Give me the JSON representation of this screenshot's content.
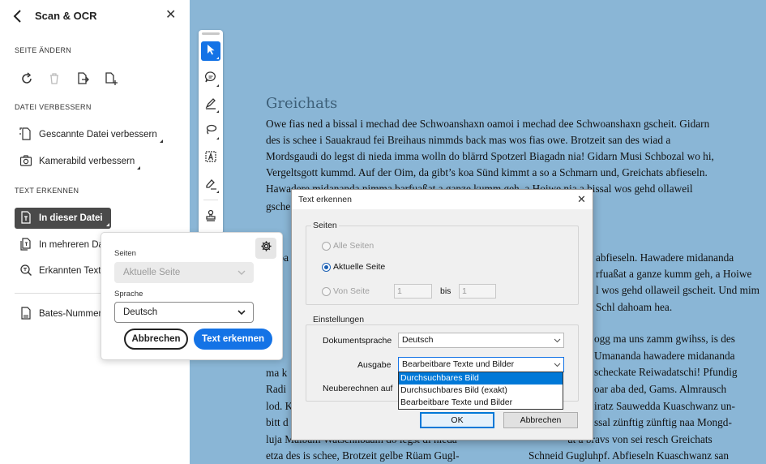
{
  "panel": {
    "title": "Scan & OCR",
    "sections": {
      "change_page": "SEITE ÄNDERN",
      "improve_file": "DATEI VERBESSERN",
      "recognize_text": "TEXT ERKENNEN"
    },
    "page_tools": [
      "rotate-icon",
      "trash-icon",
      "extract-page-icon",
      "insert-page-icon"
    ],
    "improve_items": [
      {
        "label": "Gescannte Datei verbessern",
        "icon": "scan-enhance-icon"
      },
      {
        "label": "Kamerabild verbessern",
        "icon": "camera-icon"
      }
    ],
    "recognize_items": [
      {
        "label": "In dieser Datei",
        "icon": "file-text-icon",
        "selected": true
      },
      {
        "label": "In mehreren Dateien",
        "icon": "files-text-icon"
      },
      {
        "label": "Erkannten Text korrigieren",
        "icon": "search-text-icon"
      }
    ],
    "bates": {
      "label": "Bates-Nummerierung",
      "icon": "bates-icon"
    }
  },
  "popover": {
    "pages_label": "Seiten",
    "pages_value": "Aktuelle Seite",
    "language_label": "Sprache",
    "language_value": "Deutsch",
    "cancel": "Abbrechen",
    "submit": "Text erkennen",
    "settings_icon": "gear-icon"
  },
  "toolbar": {
    "tools": [
      "select-arrow-icon",
      "comment-icon",
      "highlight-pen-icon",
      "draw-lasso-icon",
      "text-box-icon",
      "signature-icon",
      "stamp-icon"
    ]
  },
  "document": {
    "title": "Greichats",
    "lines_top": [
      "Owe fias ned a bissal i mechad dee Schwoanshaxn oamoi i mechad dee Schwoanshaxn gscheit. Gidarn",
      "des is schee i Sauakraud fei Breihaus nimmds back mas wos fias owe. Brotzeit san des wiad a",
      "Mordsgaudi do legst di nieda imma wolln do blärrd Spotzerl Biagadn nia! Gidarn Musi Schbozal wo hi,",
      "Vergeltsgott kummd. Auf der Oim, da gibt’s koa Sünd kimmt a so a Schmarn und, Greichats abfieseln.",
      "Hawadere midananda nimma barfuaßat a ganze kumm geh, a Hoiwe nia a bissal wos gehd ollaweil",
      "gsche"
    ],
    "lines_right_a": [
      "abfieseln. Hawadere midananda",
      "rfuaßat a ganze kumm geh, a Hoiwe",
      "l wos gehd ollaweil gscheit. Und mim",
      "Schl dahoam hea."
    ],
    "lines_right_b": [
      "ogg ma uns zamm gwihss, is des",
      "Umananda hawadere midananda",
      "scheckate Reiwadatschi! Pfundig",
      "oar aba ded, Gams. Almrausch",
      "iratz Sauwedda Kuaschwanz un-",
      "ssal zünftig zünftig naa Mongd-",
      "ut a bravs von sei resch Greichats",
      "Schneid Gugluhpf. Abfieseln Kuaschwanz san"
    ],
    "lines_left_b": [
      "ma k",
      "Radi",
      "lod. K",
      "bitt d",
      "luja Maibam Watschnbaam do legst di nieda",
      "etza des is schee, Brotzeit gelbe Rüam Gugl-"
    ],
    "lines_left_a": [
      "Haba",
      "s d"
    ]
  },
  "dialog": {
    "title": "Text erkennen",
    "pages_group": "Seiten",
    "radio_all": "Alle Seiten",
    "radio_current": "Aktuelle Seite",
    "radio_from": "Von Seite",
    "from_value": "1",
    "to_label": "bis",
    "to_value": "1",
    "settings_group": "Einstellungen",
    "doc_language_label": "Dokumentsprache",
    "doc_language_value": "Deutsch",
    "output_label": "Ausgabe",
    "output_value": "Bearbeitbare Texte und Bilder",
    "output_options": [
      "Durchsuchbares Bild",
      "Durchsuchbares Bild (exakt)",
      "Bearbeitbare Texte und Bilder"
    ],
    "highlighted_option": 0,
    "recalc_label": "Neuberechnen auf",
    "ok": "OK",
    "cancel": "Abbrechen"
  }
}
